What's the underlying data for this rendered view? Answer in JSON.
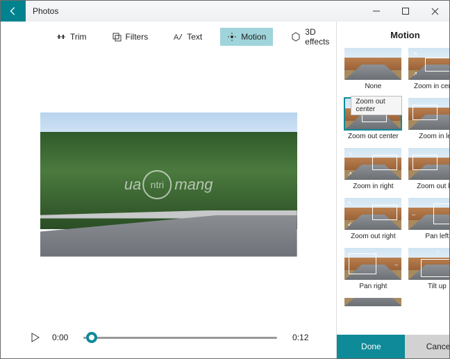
{
  "title": "Photos",
  "toolbar": {
    "trim": "Trim",
    "filters": "Filters",
    "text": "Text",
    "motion": "Motion",
    "effects": "3D effects"
  },
  "player": {
    "current": "0:00",
    "total": "0:12"
  },
  "watermark": {
    "pre": "ua",
    "mid": "ntri",
    "post": "mang"
  },
  "panel": {
    "title": "Motion",
    "tooltip": "Zoom out center",
    "items": [
      {
        "label": "None"
      },
      {
        "label": "Zoom in center"
      },
      {
        "label": "Zoom out center"
      },
      {
        "label": "Zoom in left"
      },
      {
        "label": "Zoom in right"
      },
      {
        "label": "Zoom out left"
      },
      {
        "label": "Zoom out right"
      },
      {
        "label": "Pan left"
      },
      {
        "label": "Pan right"
      },
      {
        "label": "Tilt up"
      }
    ],
    "done": "Done",
    "cancel": "Cancel"
  }
}
